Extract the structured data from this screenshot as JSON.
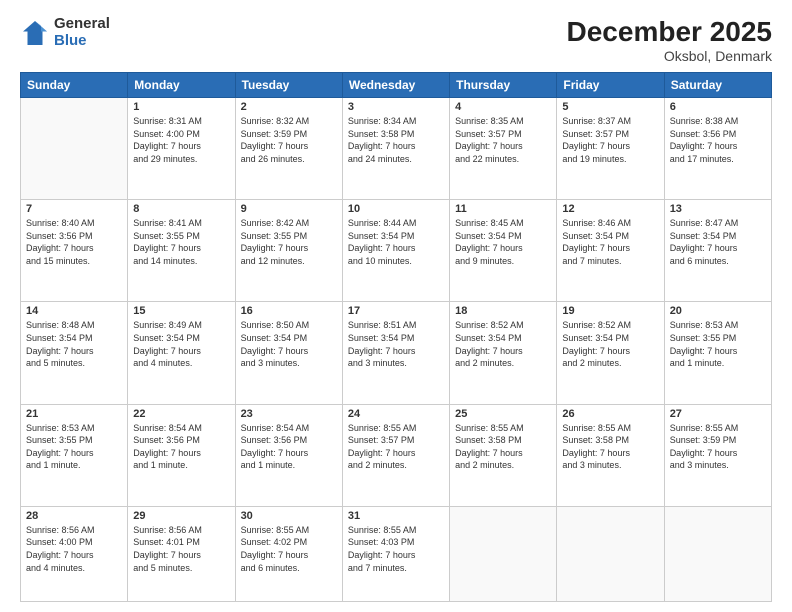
{
  "logo": {
    "general": "General",
    "blue": "Blue"
  },
  "header": {
    "title": "December 2025",
    "subtitle": "Oksbol, Denmark"
  },
  "days_of_week": [
    "Sunday",
    "Monday",
    "Tuesday",
    "Wednesday",
    "Thursday",
    "Friday",
    "Saturday"
  ],
  "weeks": [
    [
      {
        "day": "",
        "info": ""
      },
      {
        "day": "1",
        "info": "Sunrise: 8:31 AM\nSunset: 4:00 PM\nDaylight: 7 hours\nand 29 minutes."
      },
      {
        "day": "2",
        "info": "Sunrise: 8:32 AM\nSunset: 3:59 PM\nDaylight: 7 hours\nand 26 minutes."
      },
      {
        "day": "3",
        "info": "Sunrise: 8:34 AM\nSunset: 3:58 PM\nDaylight: 7 hours\nand 24 minutes."
      },
      {
        "day": "4",
        "info": "Sunrise: 8:35 AM\nSunset: 3:57 PM\nDaylight: 7 hours\nand 22 minutes."
      },
      {
        "day": "5",
        "info": "Sunrise: 8:37 AM\nSunset: 3:57 PM\nDaylight: 7 hours\nand 19 minutes."
      },
      {
        "day": "6",
        "info": "Sunrise: 8:38 AM\nSunset: 3:56 PM\nDaylight: 7 hours\nand 17 minutes."
      }
    ],
    [
      {
        "day": "7",
        "info": "Sunrise: 8:40 AM\nSunset: 3:56 PM\nDaylight: 7 hours\nand 15 minutes."
      },
      {
        "day": "8",
        "info": "Sunrise: 8:41 AM\nSunset: 3:55 PM\nDaylight: 7 hours\nand 14 minutes."
      },
      {
        "day": "9",
        "info": "Sunrise: 8:42 AM\nSunset: 3:55 PM\nDaylight: 7 hours\nand 12 minutes."
      },
      {
        "day": "10",
        "info": "Sunrise: 8:44 AM\nSunset: 3:54 PM\nDaylight: 7 hours\nand 10 minutes."
      },
      {
        "day": "11",
        "info": "Sunrise: 8:45 AM\nSunset: 3:54 PM\nDaylight: 7 hours\nand 9 minutes."
      },
      {
        "day": "12",
        "info": "Sunrise: 8:46 AM\nSunset: 3:54 PM\nDaylight: 7 hours\nand 7 minutes."
      },
      {
        "day": "13",
        "info": "Sunrise: 8:47 AM\nSunset: 3:54 PM\nDaylight: 7 hours\nand 6 minutes."
      }
    ],
    [
      {
        "day": "14",
        "info": "Sunrise: 8:48 AM\nSunset: 3:54 PM\nDaylight: 7 hours\nand 5 minutes."
      },
      {
        "day": "15",
        "info": "Sunrise: 8:49 AM\nSunset: 3:54 PM\nDaylight: 7 hours\nand 4 minutes."
      },
      {
        "day": "16",
        "info": "Sunrise: 8:50 AM\nSunset: 3:54 PM\nDaylight: 7 hours\nand 3 minutes."
      },
      {
        "day": "17",
        "info": "Sunrise: 8:51 AM\nSunset: 3:54 PM\nDaylight: 7 hours\nand 3 minutes."
      },
      {
        "day": "18",
        "info": "Sunrise: 8:52 AM\nSunset: 3:54 PM\nDaylight: 7 hours\nand 2 minutes."
      },
      {
        "day": "19",
        "info": "Sunrise: 8:52 AM\nSunset: 3:54 PM\nDaylight: 7 hours\nand 2 minutes."
      },
      {
        "day": "20",
        "info": "Sunrise: 8:53 AM\nSunset: 3:55 PM\nDaylight: 7 hours\nand 1 minute."
      }
    ],
    [
      {
        "day": "21",
        "info": "Sunrise: 8:53 AM\nSunset: 3:55 PM\nDaylight: 7 hours\nand 1 minute."
      },
      {
        "day": "22",
        "info": "Sunrise: 8:54 AM\nSunset: 3:56 PM\nDaylight: 7 hours\nand 1 minute."
      },
      {
        "day": "23",
        "info": "Sunrise: 8:54 AM\nSunset: 3:56 PM\nDaylight: 7 hours\nand 1 minute."
      },
      {
        "day": "24",
        "info": "Sunrise: 8:55 AM\nSunset: 3:57 PM\nDaylight: 7 hours\nand 2 minutes."
      },
      {
        "day": "25",
        "info": "Sunrise: 8:55 AM\nSunset: 3:58 PM\nDaylight: 7 hours\nand 2 minutes."
      },
      {
        "day": "26",
        "info": "Sunrise: 8:55 AM\nSunset: 3:58 PM\nDaylight: 7 hours\nand 3 minutes."
      },
      {
        "day": "27",
        "info": "Sunrise: 8:55 AM\nSunset: 3:59 PM\nDaylight: 7 hours\nand 3 minutes."
      }
    ],
    [
      {
        "day": "28",
        "info": "Sunrise: 8:56 AM\nSunset: 4:00 PM\nDaylight: 7 hours\nand 4 minutes."
      },
      {
        "day": "29",
        "info": "Sunrise: 8:56 AM\nSunset: 4:01 PM\nDaylight: 7 hours\nand 5 minutes."
      },
      {
        "day": "30",
        "info": "Sunrise: 8:55 AM\nSunset: 4:02 PM\nDaylight: 7 hours\nand 6 minutes."
      },
      {
        "day": "31",
        "info": "Sunrise: 8:55 AM\nSunset: 4:03 PM\nDaylight: 7 hours\nand 7 minutes."
      },
      {
        "day": "",
        "info": ""
      },
      {
        "day": "",
        "info": ""
      },
      {
        "day": "",
        "info": ""
      }
    ]
  ]
}
